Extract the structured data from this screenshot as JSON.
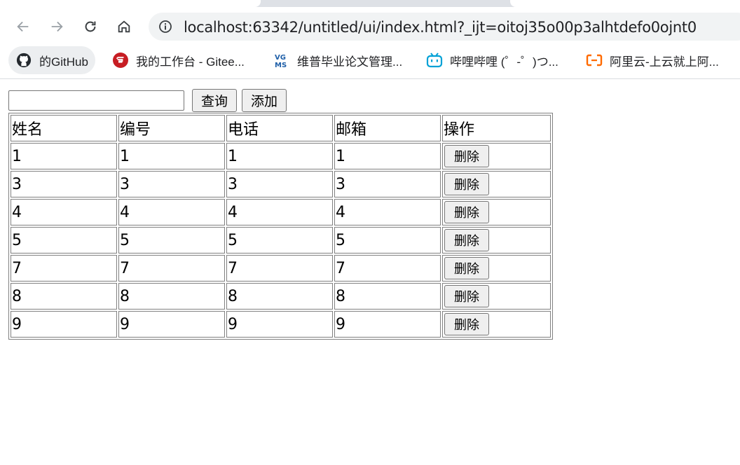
{
  "browser": {
    "url": "localhost:63342/untitled/ui/index.html?_ijt=oitoj35o00p3alhtdefo0ojnt0",
    "bookmarks": [
      {
        "label": "的GitHub",
        "icon": "github-icon"
      },
      {
        "label": "我的工作台 - Gitee...",
        "icon": "gitee-icon"
      },
      {
        "label": "维普毕业论文管理...",
        "icon": "vgms-icon"
      },
      {
        "label": "哔哩哔哩 (゜-゜)つ...",
        "icon": "bilibili-icon"
      },
      {
        "label": "阿里云-上云就上阿...",
        "icon": "aliyun-icon"
      }
    ]
  },
  "search": {
    "value": "",
    "query_label": "查询",
    "add_label": "添加"
  },
  "table": {
    "headers": [
      "姓名",
      "编号",
      "电话",
      "邮箱",
      "操作"
    ],
    "delete_label": "删除",
    "rows": [
      [
        "1",
        "1",
        "1",
        "1"
      ],
      [
        "3",
        "3",
        "3",
        "3"
      ],
      [
        "4",
        "4",
        "4",
        "4"
      ],
      [
        "5",
        "5",
        "5",
        "5"
      ],
      [
        "7",
        "7",
        "7",
        "7"
      ],
      [
        "8",
        "8",
        "8",
        "8"
      ],
      [
        "9",
        "9",
        "9",
        "9"
      ]
    ]
  },
  "colors": {
    "gitee": "#c71d23",
    "vgms": "#1f5fa8",
    "bilibili": "#00a1d6",
    "aliyun": "#ff6a00"
  }
}
